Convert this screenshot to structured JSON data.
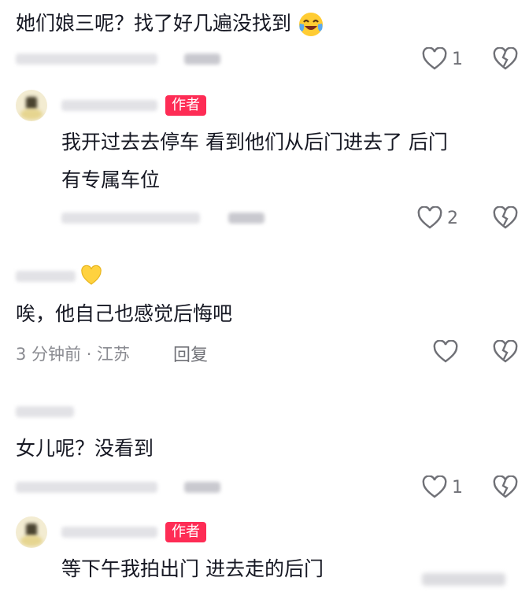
{
  "comments": [
    {
      "text": "她们娘三呢？找了好几遍没找到",
      "likes": "1"
    },
    {
      "is_reply": true,
      "badge": "作者",
      "text_line1": "我开过去去停车 看到他们从后门进去了 后门",
      "text_line2": "有专属车位",
      "likes": "2"
    },
    {
      "text": "唉，他自己也感觉后悔吧",
      "time_location": "3 分钟前 · 江苏",
      "reply_label": "回复"
    },
    {
      "text": "女儿呢？没看到",
      "likes": "1"
    },
    {
      "is_reply": true,
      "badge": "作者",
      "text": "等下午我拍出门 进去走的后门"
    }
  ],
  "colors": {
    "badge": "#fe2c55",
    "text": "#161823",
    "meta": "#8a8b91"
  },
  "icons": [
    "laughing-crying-emoji-icon",
    "heart-icon",
    "dislike-broken-heart-icon",
    "yellow-heart-emoji-icon"
  ]
}
